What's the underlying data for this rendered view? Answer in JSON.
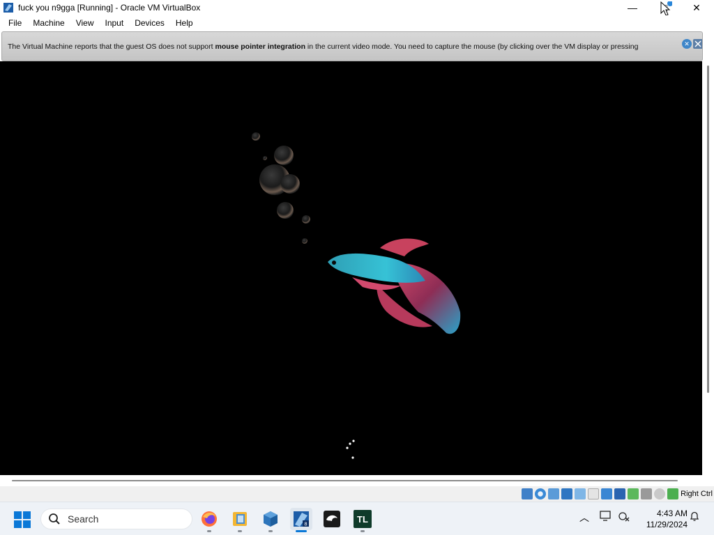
{
  "window": {
    "title": "fuck you n9gga [Running] - Oracle VM VirtualBox",
    "minimize_icon": "—",
    "maximize_icon": "□",
    "close_icon": "✕"
  },
  "menu": [
    "File",
    "Machine",
    "View",
    "Input",
    "Devices",
    "Help"
  ],
  "notice": {
    "prefix": "The Virtual Machine reports that the guest OS does not support ",
    "bold": "mouse pointer integration",
    "suffix": " in the current video mode. You need to capture the mouse (by clicking over the VM display or pressing"
  },
  "statusbar": {
    "icons": [
      "hard-disk-icon",
      "optical-drive-icon",
      "audio-icon",
      "network-icon",
      "usb-icon",
      "shared-folders-icon",
      "display-icon",
      "video-capture-icon",
      "graphics-acceleration-icon",
      "cpu-icon",
      "mouse-integration-icon",
      "host-key-icon"
    ],
    "host_key": "Right Ctrl"
  },
  "taskbar": {
    "search_placeholder": "Search",
    "apps": [
      "firefox",
      "file-manager",
      "virtualbox",
      "virtualbox-vm",
      "inkscape",
      "tl-app"
    ],
    "tl_label": "TL",
    "time": "4:43 AM",
    "date": "11/29/2024"
  },
  "colors": {
    "accent": "#0a78d7",
    "vm_background": "#000000",
    "notice_background": "#c8c8c8"
  }
}
